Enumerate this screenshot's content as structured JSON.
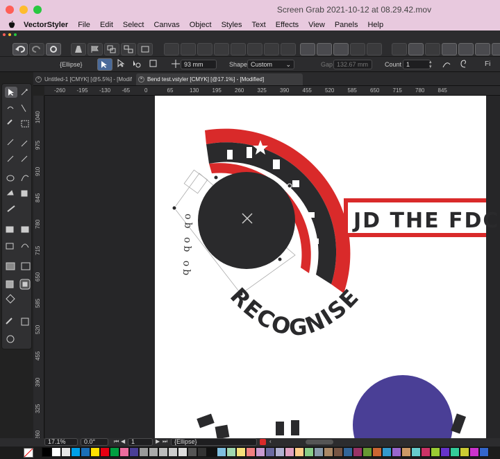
{
  "window": {
    "title": "Screen Grab 2021-10-12 at 08.29.42.mov",
    "traffic_colors": [
      "#ff5f57",
      "#febc2e",
      "#28c840"
    ]
  },
  "menu": {
    "apple": "",
    "items": [
      "VectorStyler",
      "File",
      "Edit",
      "Select",
      "Canvas",
      "Object",
      "Styles",
      "Text",
      "Effects",
      "View",
      "Panels",
      "Help"
    ]
  },
  "context_bar": {
    "object_type": "{Ellipse}",
    "size_value": "93 mm",
    "shape_label": "Shape",
    "shape_value": "Custom",
    "gap_label": "Gap",
    "gap_value": "132.67 mm",
    "count_label": "Count",
    "count_value": "1"
  },
  "tabs": [
    {
      "label": "Untitled-1 [CMYK] [@5.5%] - [Modif"
    },
    {
      "label": "Bend  test.vstyler [CMYK] [@17.1%] - [Modified]"
    }
  ],
  "ruler": {
    "h_ticks": [
      "-260",
      "-195",
      "-130",
      "-65",
      "0",
      "65",
      "130",
      "195",
      "260",
      "325",
      "390",
      "455",
      "520",
      "585",
      "650",
      "715",
      "780",
      "845"
    ],
    "v_ticks": [
      "1040",
      "975",
      "910",
      "845",
      "780",
      "715",
      "650",
      "585",
      "520",
      "455",
      "390",
      "325",
      "260"
    ]
  },
  "artwork": {
    "ring_text": "JD THE FDCS",
    "banner_text": "JD THE FDCS",
    "arc_bottom_text": "RECOGNISE",
    "small_arc_text": "ob ob ob",
    "accent_red": "#d92a2a",
    "dark": "#2a2a2c",
    "circle_purple": "#4a3f96"
  },
  "status": {
    "zoom": "17.1%",
    "rotation": "0.0°",
    "page": "1",
    "selection": "{Ellipse}"
  },
  "swatch_colors": [
    "#000000",
    "#ffffff",
    "#e6e6e6",
    "#00a0e9",
    "#1b6fb7",
    "#ffe100",
    "#e60012",
    "#00a040",
    "#ec6d9d",
    "#4a3f96",
    "#999999",
    "#aaaaaa",
    "#bbbbbb",
    "#cccccc",
    "#dddddd",
    "#555555",
    "#333333",
    "#111111",
    "#7fbfe0",
    "#a0d8b0",
    "#f5e07a",
    "#f08080",
    "#c89ad0",
    "#6a6aa0",
    "#b0b0d0",
    "#e0a0c0",
    "#ffcc88",
    "#88cc88",
    "#8899aa",
    "#aa8866",
    "#775544",
    "#336699",
    "#993366",
    "#669933",
    "#cc6633",
    "#3399cc",
    "#9966cc",
    "#cc9966",
    "#66cccc",
    "#cc3366",
    "#99cc33",
    "#6633cc",
    "#33cc99",
    "#cccc33",
    "#cc33cc",
    "#3366cc"
  ]
}
